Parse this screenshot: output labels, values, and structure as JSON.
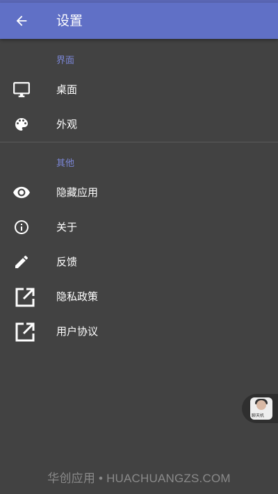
{
  "appbar": {
    "title": "设置",
    "back_icon": "arrow-back-icon"
  },
  "sections": [
    {
      "header": "界面",
      "items": [
        {
          "label": "桌面",
          "icon": "monitor-icon"
        },
        {
          "label": "外观",
          "icon": "palette-icon"
        }
      ]
    },
    {
      "header": "其他",
      "items": [
        {
          "label": "隐藏应用",
          "icon": "eye-icon"
        },
        {
          "label": "关于",
          "icon": "info-icon"
        },
        {
          "label": "反馈",
          "icon": "pencil-icon"
        },
        {
          "label": "隐私政策",
          "icon": "open-external-icon"
        },
        {
          "label": "用户协议",
          "icon": "open-external-icon"
        }
      ]
    }
  ],
  "floating_widget": {
    "tag": "聊天机"
  },
  "watermark": "华创应用 • HUACHUANGZS.COM",
  "colors": {
    "appbar": "#6070c6",
    "accent": "#7b86d6",
    "background": "#424242"
  }
}
